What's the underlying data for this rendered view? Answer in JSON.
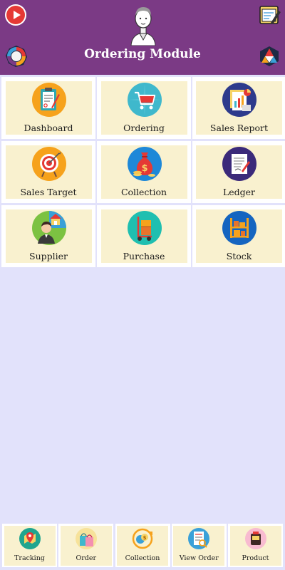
{
  "header": {
    "title": "Ordering Module",
    "icons": {
      "play": "youtube-play-icon",
      "top_right": "notes-pencil-icon",
      "avatar": "user-avatar-icon",
      "left_badge": "colorful-ring-icon",
      "right_badge": "triangle-mosaic-icon"
    }
  },
  "modules": [
    {
      "label": "Dashboard",
      "icon": "clipboard-report-icon"
    },
    {
      "label": "Ordering",
      "icon": "shopping-cart-icon"
    },
    {
      "label": "Sales Report",
      "icon": "sales-report-icon"
    },
    {
      "label": "Sales Target",
      "icon": "target-icon"
    },
    {
      "label": "Collection",
      "icon": "money-bag-icon"
    },
    {
      "label": "Ledger",
      "icon": "ledger-icon"
    },
    {
      "label": "Supplier",
      "icon": "supplier-icon"
    },
    {
      "label": "Purchase",
      "icon": "hand-truck-icon"
    },
    {
      "label": "Stock",
      "icon": "stock-shelf-icon"
    }
  ],
  "bottom_nav": [
    {
      "label": "Tracking",
      "icon": "tracking-icon"
    },
    {
      "label": "Order",
      "icon": "shopping-bag-icon"
    },
    {
      "label": "Collection",
      "icon": "coins-collection-icon"
    },
    {
      "label": "View Order",
      "icon": "view-order-icon"
    },
    {
      "label": "Product",
      "icon": "product-icon"
    }
  ],
  "colors": {
    "header": "#7b3a85",
    "background": "#e2e2fb",
    "card": "#f9f1cf"
  }
}
